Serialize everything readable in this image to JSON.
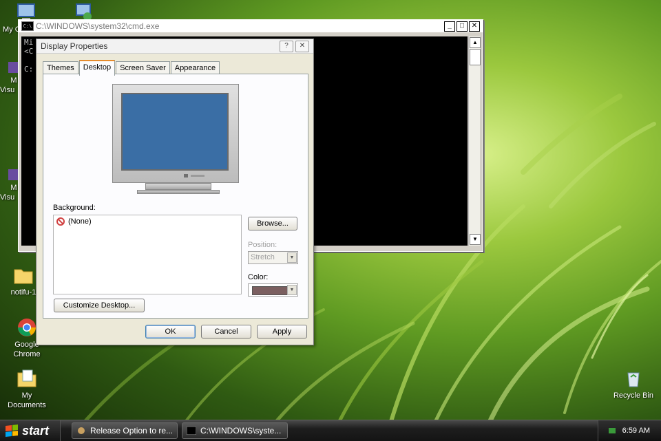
{
  "desktop": {
    "icons": [
      {
        "label": "My C",
        "icon": "my-computer-icon"
      },
      {
        "label": "",
        "icon": "network-icon"
      },
      {
        "label": "M",
        "label2": "Visu",
        "icon": "visual-studio-icon"
      },
      {
        "label": "M",
        "label2": "Visu",
        "icon": "visual-studio-icon"
      },
      {
        "label": "notifu-1",
        "icon": "folder-icon"
      },
      {
        "label": "Google",
        "label2": "Chrome",
        "icon": "chrome-icon"
      },
      {
        "label": "My",
        "label2": "Documents",
        "icon": "my-documents-icon"
      },
      {
        "label": "Recycle Bin",
        "icon": "recycle-bin-icon"
      }
    ]
  },
  "cmd": {
    "title": "C:\\WINDOWS\\system32\\cmd.exe",
    "lines": [
      "Mi",
      "<C",
      "",
      "C:"
    ]
  },
  "dialog": {
    "title": "Display Properties",
    "help": "?",
    "close": "✕",
    "tabs": [
      "Themes",
      "Desktop",
      "Screen Saver",
      "Appearance"
    ],
    "active_tab": "Desktop",
    "background_label": "Background:",
    "background_items": [
      "(None)"
    ],
    "browse": "Browse...",
    "position_label": "Position:",
    "position_value": "Stretch",
    "color_label": "Color:",
    "color_value": "#7b5f60",
    "customize": "Customize Desktop...",
    "ok": "OK",
    "cancel": "Cancel",
    "apply": "Apply"
  },
  "taskbar": {
    "start": "start",
    "items": [
      "Release Option to re...",
      "C:\\WINDOWS\\syste..."
    ],
    "clock": "6:59 AM"
  }
}
